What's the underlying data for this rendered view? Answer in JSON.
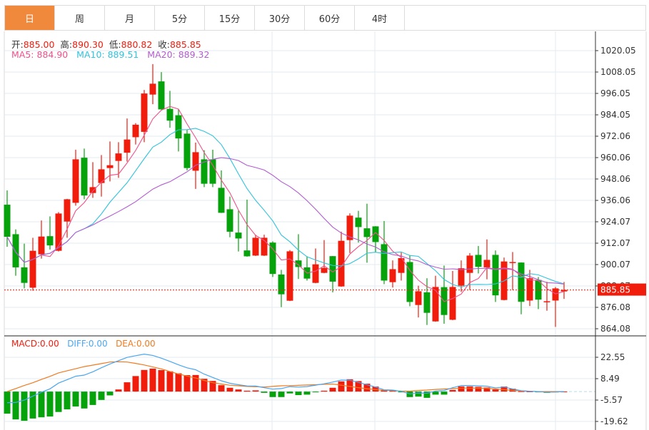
{
  "tabs": [
    {
      "label": "日",
      "active": true
    },
    {
      "label": "周"
    },
    {
      "label": "月"
    },
    {
      "label": "5分"
    },
    {
      "label": "15分"
    },
    {
      "label": "30分"
    },
    {
      "label": "60分"
    },
    {
      "label": "4时"
    }
  ],
  "ohlc_info": {
    "open_label": "开:",
    "open": "885.00",
    "high_label": "高:",
    "high": "890.30",
    "low_label": "低:",
    "low": "880.82",
    "close_label": "收:",
    "close": "885.85"
  },
  "ma_info": {
    "ma5_label": "MA5:",
    "ma5": "884.90",
    "ma10_label": "MA10:",
    "ma10": "889.51",
    "ma20_label": "MA20:",
    "ma20": "889.32"
  },
  "macd_info": {
    "macd_label": "MACD:",
    "macd": "0.00",
    "diff_label": "DIFF:",
    "diff": "0.00",
    "dea_label": "DEA:",
    "dea": "0.00"
  },
  "colors": {
    "up": "#f01c0c",
    "down": "#06a20c",
    "ma5": "#f0508a",
    "ma10": "#30c3dc",
    "ma20": "#b25cd0",
    "diff": "#4aa6f0",
    "dea": "#f07a20",
    "accent": "#f0893c"
  },
  "chart_data": {
    "type": "candlestick",
    "price_axis": {
      "ylim": [
        864.08,
        1020.05
      ],
      "ticks": [
        "1020.05",
        "1008.05",
        "996.05",
        "984.05",
        "972.06",
        "960.06",
        "948.06",
        "936.06",
        "924.07",
        "912.07",
        "900.07",
        "888.07",
        "876.08",
        "864.08"
      ]
    },
    "last_price": "885.85",
    "candles": [
      [
        933.65,
        915.65,
        941.65,
        910.05
      ],
      [
        917.1,
        898.5,
        919.8,
        893.8
      ],
      [
        898.5,
        889.8,
        911.8,
        886.7
      ],
      [
        887.1,
        907.8,
        915.1,
        885.4
      ],
      [
        905.8,
        915.8,
        924.8,
        903.4
      ],
      [
        916.0,
        910.8,
        927.1,
        908.5
      ],
      [
        907.8,
        928.7,
        929.5,
        907.4
      ],
      [
        924.2,
        936.7,
        936.9,
        915.1
      ],
      [
        934.7,
        959.1,
        964.5,
        933.1
      ],
      [
        960.0,
        938.8,
        965.1,
        936.7
      ],
      [
        940.2,
        943.5,
        957.5,
        937.5
      ],
      [
        945.8,
        953.5,
        961.5,
        938.2
      ],
      [
        954.2,
        955.8,
        969.1,
        946.7
      ],
      [
        958.2,
        962.4,
        968.7,
        948.7
      ],
      [
        962.8,
        970.2,
        982.0,
        957.8
      ],
      [
        971.5,
        978.5,
        979.4,
        967.4
      ],
      [
        974.5,
        996.0,
        998.0,
        968.7
      ],
      [
        995.4,
        1001.5,
        1012.5,
        990.0
      ],
      [
        1002.8,
        987.1,
        1008.0,
        986.9
      ],
      [
        987.4,
        980.8,
        997.5,
        976.8
      ],
      [
        983.8,
        970.8,
        987.1,
        963.5
      ],
      [
        973.5,
        954.2,
        975.8,
        952.9
      ],
      [
        952.7,
        963.1,
        968.5,
        942.5
      ],
      [
        959.1,
        945.4,
        964.2,
        943.5
      ],
      [
        959.1,
        945.4,
        964.5,
        943.5
      ],
      [
        943.1,
        929.1,
        952.9,
        929.0
      ],
      [
        931.1,
        918.5,
        938.2,
        915.4
      ],
      [
        918.0,
        914.7,
        930.4,
        907.4
      ],
      [
        908.0,
        904.7,
        936.5,
        904.5
      ],
      [
        905.1,
        915.1,
        916.8,
        904.9
      ],
      [
        905.1,
        915.1,
        916.8,
        904.9
      ],
      [
        912.4,
        894.8,
        913.1,
        893.1
      ],
      [
        894.5,
        883.4,
        897.1,
        876.2
      ],
      [
        879.8,
        907.5,
        908.2,
        879.6
      ],
      [
        902.4,
        898.7,
        917.1,
        892.0
      ],
      [
        898.5,
        892.2,
        904.7,
        891.1
      ],
      [
        889.8,
        900.2,
        909.1,
        889.6
      ],
      [
        895.4,
        898.2,
        913.8,
        895.2
      ],
      [
        904.8,
        890.5,
        904.9,
        884.5
      ],
      [
        887.8,
        913.4,
        918.5,
        887.6
      ],
      [
        913.8,
        927.5,
        928.8,
        906.5
      ],
      [
        926.4,
        921.1,
        930.2,
        912.4
      ],
      [
        920.4,
        915.5,
        934.2,
        901.1
      ],
      [
        921.5,
        912.7,
        921.6,
        907.1
      ],
      [
        911.5,
        891.1,
        924.5,
        889.1
      ],
      [
        890.2,
        897.5,
        902.4,
        887.2
      ],
      [
        895.4,
        903.7,
        906.8,
        891.1
      ],
      [
        901.5,
        879.1,
        905.1,
        876.7
      ],
      [
        877.4,
        885.1,
        888.2,
        870.4
      ],
      [
        884.5,
        873.0,
        892.4,
        866.2
      ],
      [
        868.2,
        887.5,
        893.8,
        868.0
      ],
      [
        887.4,
        871.8,
        899.5,
        866.9
      ],
      [
        869.1,
        887.5,
        896.5,
        868.9
      ],
      [
        888.2,
        898.0,
        902.4,
        884.7
      ],
      [
        895.4,
        905.1,
        906.5,
        885.8
      ],
      [
        905.5,
        898.8,
        910.5,
        895.1
      ],
      [
        898.5,
        902.7,
        914.2,
        891.8
      ],
      [
        905.5,
        882.8,
        908.0,
        879.1
      ],
      [
        880.2,
        901.8,
        904.0,
        880.0
      ],
      [
        901.1,
        901.5,
        907.1,
        885.8
      ],
      [
        901.2,
        879.2,
        901.3,
        872.2
      ],
      [
        879.9,
        892.4,
        897.1,
        876.8
      ],
      [
        891.5,
        880.4,
        893.1,
        875.1
      ],
      [
        879.1,
        879.5,
        890.4,
        874.2
      ],
      [
        879.9,
        886.7,
        887.5,
        865.1
      ],
      [
        885.0,
        885.85,
        890.3,
        880.82
      ]
    ],
    "macd_axis": {
      "ylim": [
        -19.62,
        22.55
      ],
      "ticks": [
        "22.55",
        "8.49",
        "-5.57",
        "-19.62"
      ]
    },
    "macd_hist": [
      -14.5,
      -18.3,
      -19.2,
      -17.7,
      -16.9,
      -16.4,
      -13.4,
      -11.7,
      -9.8,
      -11.1,
      -8.8,
      -5.5,
      -2.5,
      1.4,
      6.1,
      10.2,
      14.2,
      15.1,
      14.1,
      13.3,
      12.0,
      10.8,
      10.9,
      8.4,
      7.0,
      4.2,
      2.5,
      1.4,
      0.6,
      0.8,
      -0.8,
      -3.6,
      -3.6,
      -1.2,
      -2.3,
      -2.0,
      -0.5,
      0.6,
      2.5,
      6.7,
      8.1,
      6.9,
      5.2,
      3.3,
      0.8,
      0.8,
      -0.5,
      -3.6,
      -3.3,
      -4.1,
      -2.0,
      -2.0,
      1.1,
      3.4,
      3.4,
      3.1,
      2.7,
      1.4,
      3.3,
      1.9,
      0.2,
      0.1,
      -0.1,
      -0.8,
      -0.5,
      0.0
    ],
    "dea": [
      0,
      2,
      4,
      5.8,
      8,
      10,
      12.3,
      13.7,
      15,
      16.4,
      17.4,
      18.4,
      19.4,
      19.6,
      19.4,
      18.5,
      17.5,
      16.2,
      14.9,
      13.2,
      11.6,
      10.2,
      8.9,
      7.3,
      5.8,
      5.0,
      4.2,
      3.8,
      3.4,
      3.2,
      3.0,
      3.4,
      3.8,
      3.9,
      4.1,
      4.3,
      4.5,
      4.8,
      5.0,
      4.2,
      3.4,
      2.6,
      1.9,
      1.3,
      0.8,
      0.6,
      0.4,
      0.3,
      0.7,
      1.0,
      1.4,
      1.7,
      2.0,
      2.3,
      2.3,
      2.2,
      2.2,
      1.7,
      1.3,
      0.8,
      0.5,
      0.2,
      0,
      0,
      0,
      0
    ]
  }
}
